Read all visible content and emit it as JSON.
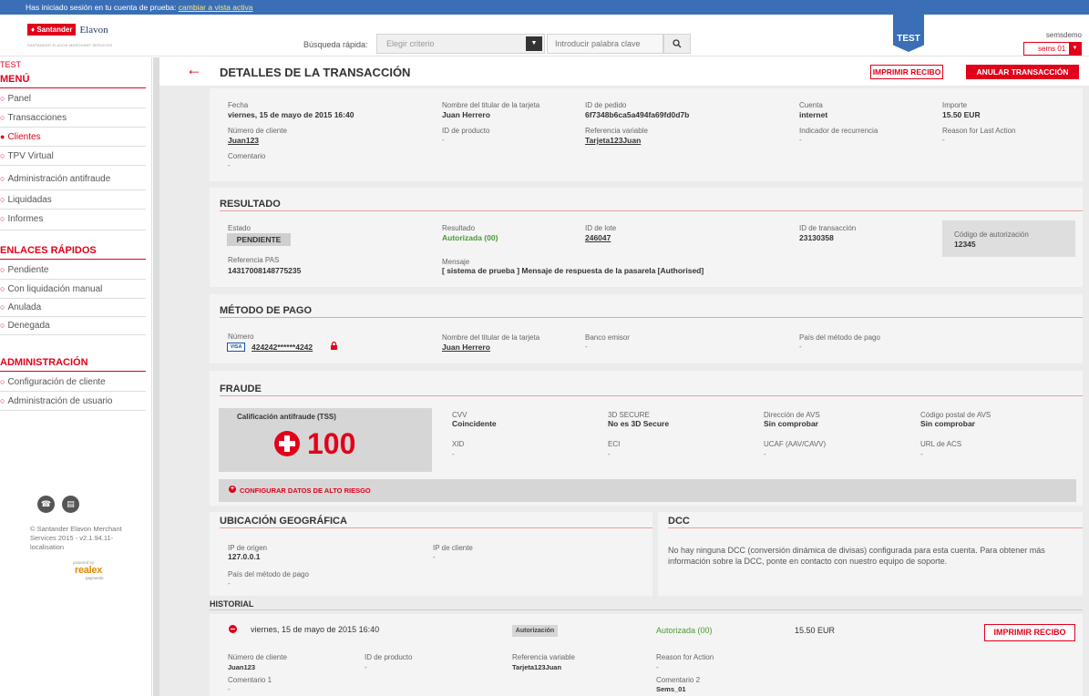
{
  "trial": {
    "text": "Has iniciado sesión en tu cuenta de prueba:",
    "link": "cambiar a vista activa"
  },
  "header": {
    "logo_santander": "Santander",
    "logo_elavon": "Elavon",
    "logo_sub": "SANTANDER ELAVON MERCHANT SERVICES",
    "quick_search_label": "Búsqueda rápida:",
    "criteria_placeholder": "Elegir criterio",
    "keyword_placeholder": "Introducir palabra clave",
    "test_badge": "TEST",
    "username": "semsdemo",
    "account": "sems 01"
  },
  "sidebar": {
    "test_label": "TEST",
    "menu_title": "MENÚ",
    "menu_items": [
      {
        "label": "Panel"
      },
      {
        "label": "Transacciones"
      },
      {
        "label": "Clientes"
      },
      {
        "label": "TPV Virtual"
      },
      {
        "label": "Administración antifraude"
      },
      {
        "label": "Liquidadas"
      },
      {
        "label": "Informes"
      }
    ],
    "quick_title": "ENLACES RÁPIDOS",
    "quick_items": [
      {
        "label": "Pendiente"
      },
      {
        "label": "Con liquidación manual"
      },
      {
        "label": "Anulada"
      },
      {
        "label": "Denegada"
      }
    ],
    "admin_title": "ADMINISTRACIÓN",
    "admin_items": [
      {
        "label": "Configuración de cliente"
      },
      {
        "label": "Administración de usuario"
      }
    ],
    "copyright": "© Santander Elavon Merchant Services 2015 - v2.1.94.11-localisation",
    "powered_by": "powered by",
    "realex": "realex",
    "realex_sub": "payments"
  },
  "page": {
    "title": "DETALLES DE LA TRANSACCIÓN",
    "print_button": "IMPRIMIR RECIBO",
    "cancel_button": "ANULAR TRANSACCIÓN"
  },
  "details": {
    "fecha_label": "Fecha",
    "fecha": "viernes, 15 de mayo de 2015 16:40",
    "titular_label": "Nombre del titular de la tarjeta",
    "titular": "Juan Herrero",
    "pedido_label": "ID de pedido",
    "pedido": "6f7348b6ca5a494fa69fd0d7b",
    "cuenta_label": "Cuenta",
    "cuenta": "internet",
    "importe_label": "Importe",
    "importe": "15.50 EUR",
    "cliente_label": "Número de cliente",
    "cliente": "Juan123",
    "producto_label": "ID de producto",
    "producto": "-",
    "referencia_label": "Referencia variable",
    "referencia": "Tarjeta123Juan",
    "recurrencia_label": "Indicador de recurrencia",
    "recurrencia": "-",
    "reason_label": "Reason for Last Action",
    "reason": "-",
    "comentario_label": "Comentario",
    "comentario": "-"
  },
  "resultado": {
    "title": "RESULTADO",
    "estado_label": "Estado",
    "estado": "PENDIENTE",
    "resultado_label": "Resultado",
    "resultado": "Autorizada (00)",
    "lote_label": "ID de lote",
    "lote": "246047",
    "transaccion_label": "ID de transacción",
    "transaccion": "23130358",
    "autorizacion_label": "Código de autorización",
    "autorizacion": "12345",
    "pas_label": "Referencia PAS",
    "pas": "14317008148775235",
    "mensaje_label": "Mensaje",
    "mensaje": "[ sistema de prueba ] Mensaje de respuesta de la pasarela [Authorised]"
  },
  "metodo": {
    "title": "MÉTODO DE PAGO",
    "numero_label": "Número",
    "card_brand": "VISA",
    "numero": "424242******4242",
    "titular_label": "Nombre del titular de la tarjeta",
    "titular": "Juan Herrero",
    "banco_label": "Banco emisor",
    "banco": "-",
    "pais_label": "País del método de pago",
    "pais": "-"
  },
  "fraude": {
    "title": "FRAUDE",
    "score_label": "Calificación antifraude (TSS)",
    "score": "100",
    "cvv_label": "CVV",
    "cvv": "Coincidente",
    "secure_label": "3D SECURE",
    "secure": "No es 3D Secure",
    "avs_label": "Dirección de AVS",
    "avs": "Sin comprobar",
    "postal_label": "Código postal de AVS",
    "postal": "Sin comprobar",
    "xid_label": "XID",
    "xid": "-",
    "eci_label": "ECI",
    "eci": "-",
    "ucaf_label": "UCAF (AAV/CAVV)",
    "ucaf": "-",
    "acs_label": "URL de ACS",
    "acs": "-",
    "config_link": "CONFIGURAR DATOS DE ALTO RIESGO"
  },
  "geo": {
    "title": "UBICACIÓN GEOGRÁFICA",
    "ip_origen_label": "IP de origen",
    "ip_origen": "127.0.0.1",
    "ip_cliente_label": "IP de cliente",
    "ip_cliente": "-",
    "pais_label": "País del método de pago",
    "pais": "-"
  },
  "dcc": {
    "title": "DCC",
    "text": "No hay ninguna DCC (conversión dinámica de divisas) configurada para esta cuenta. Para obtener más información sobre la DCC, ponte en contacto con nuestro equipo de soporte."
  },
  "historial": {
    "title": "HISTORIAL",
    "date": "viernes, 15 de mayo de 2015 16:40",
    "type": "Autorización",
    "status": "Autorizada (00)",
    "amount": "15.50 EUR",
    "print_button": "IMPRIMIR RECIBO",
    "cliente_label": "Número de cliente",
    "cliente": "Juan123",
    "producto_label": "ID de producto",
    "producto": "-",
    "referencia_label": "Referencia variable",
    "referencia": "Tarjeta123Juan",
    "reason_label": "Reason for Action",
    "reason": "-",
    "comentario1_label": "Comentario 1",
    "comentario1": "-",
    "comentario2_label": "Comentario 2",
    "comentario2": "Sems_01"
  },
  "colors": {
    "brand_red": "#e2001a",
    "trial_blue": "#3a6fb7",
    "success_green": "#4a9a33"
  }
}
